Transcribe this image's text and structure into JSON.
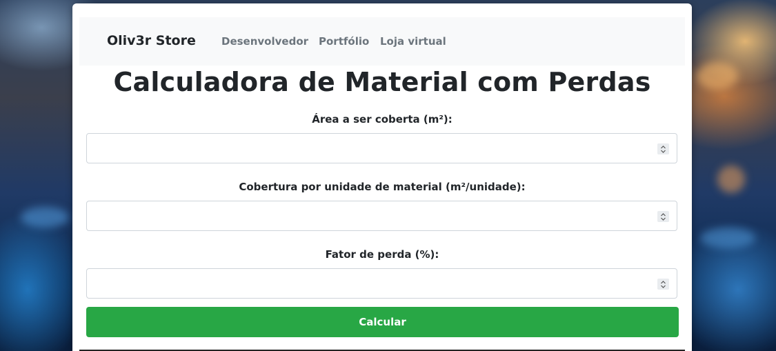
{
  "navbar": {
    "brand": "Oliv3r Store",
    "links": [
      {
        "label": "Desenvolvedor"
      },
      {
        "label": "Portfólio"
      },
      {
        "label": "Loja virtual"
      }
    ]
  },
  "page": {
    "title": "Calculadora de Material com Perdas"
  },
  "form": {
    "fields": [
      {
        "label": "Área a ser coberta (m²):",
        "value": ""
      },
      {
        "label": "Cobertura por unidade de material (m²/unidade):",
        "value": ""
      },
      {
        "label": "Fator de perda (%):",
        "value": ""
      }
    ],
    "submit_label": "Calcular"
  },
  "colors": {
    "accent": "#28a745",
    "navbar_bg": "#f8f9fa",
    "nav_link": "#6c757d"
  },
  "icons": {
    "spinner": "up-down-arrows-icon"
  }
}
